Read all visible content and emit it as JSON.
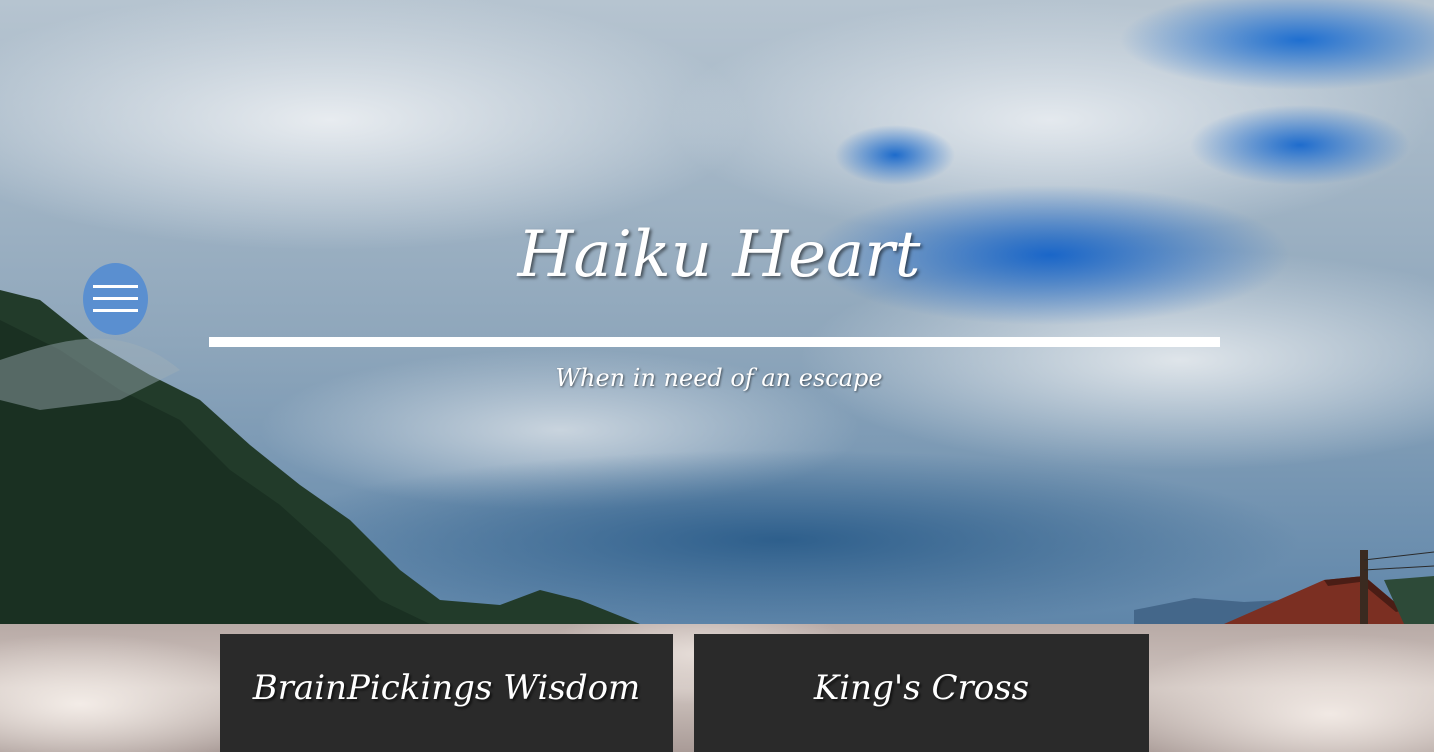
{
  "header": {
    "title": "Haiku Heart",
    "tagline": "When in need of an escape"
  },
  "menu": {
    "icon": "hamburger-menu-icon",
    "color": "#5a8fd0"
  },
  "cards": [
    {
      "title": "BrainPickings Wisdom"
    },
    {
      "title": "King's Cross"
    }
  ],
  "colors": {
    "card_background": "#2a2a2a",
    "text": "#ffffff"
  }
}
